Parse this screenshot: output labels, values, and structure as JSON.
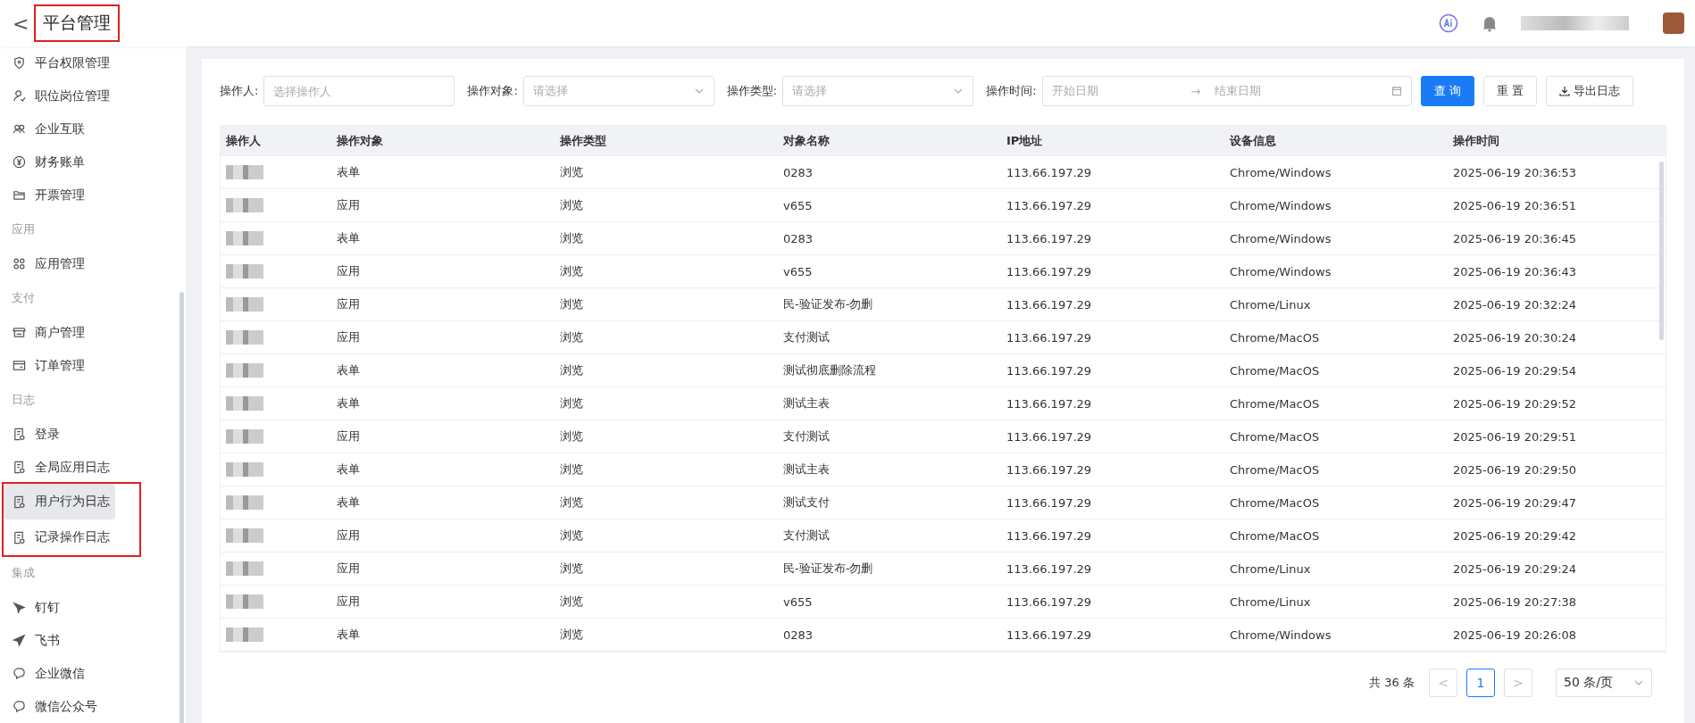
{
  "header": {
    "back": "<",
    "title": "平台管理",
    "title_highlighted": true
  },
  "sidebar": [
    {
      "kind": "item",
      "label": "平台权限管理",
      "selected": false,
      "highlighted": false
    },
    {
      "kind": "item",
      "label": "职位岗位管理",
      "selected": false,
      "highlighted": false
    },
    {
      "kind": "item",
      "label": "企业互联",
      "selected": false,
      "highlighted": false
    },
    {
      "kind": "item",
      "label": "财务账单",
      "selected": false,
      "highlighted": false
    },
    {
      "kind": "item",
      "label": "开票管理",
      "selected": false,
      "highlighted": false
    },
    {
      "kind": "section",
      "label": "应用"
    },
    {
      "kind": "item",
      "label": "应用管理",
      "selected": false,
      "highlighted": false
    },
    {
      "kind": "section",
      "label": "支付"
    },
    {
      "kind": "item",
      "label": "商户管理",
      "selected": false,
      "highlighted": false
    },
    {
      "kind": "item",
      "label": "订单管理",
      "selected": false,
      "highlighted": false
    },
    {
      "kind": "section",
      "label": "日志"
    },
    {
      "kind": "item",
      "label": "登录",
      "selected": false,
      "highlighted": false
    },
    {
      "kind": "item",
      "label": "全局应用日志",
      "selected": false,
      "highlighted": false
    },
    {
      "kind": "item",
      "label": "用户行为日志",
      "selected": true,
      "highlighted": true
    },
    {
      "kind": "item",
      "label": "记录操作日志",
      "selected": false,
      "highlighted": true
    },
    {
      "kind": "section",
      "label": "集成"
    },
    {
      "kind": "item",
      "label": "钉钉",
      "selected": false,
      "highlighted": false
    },
    {
      "kind": "item",
      "label": "飞书",
      "selected": false,
      "highlighted": false
    },
    {
      "kind": "item",
      "label": "企业微信",
      "selected": false,
      "highlighted": false
    },
    {
      "kind": "item",
      "label": "微信公众号",
      "selected": false,
      "highlighted": false
    }
  ],
  "filters": [
    {
      "kind": "text",
      "label": "操作人:",
      "placeholder": "选择操作人"
    },
    {
      "kind": "select",
      "label": "操作对象:",
      "placeholder": "请选择"
    },
    {
      "kind": "select",
      "label": "操作类型:",
      "placeholder": "请选择"
    },
    {
      "kind": "daterange",
      "label": "操作时间:",
      "start_placeholder": "开始日期",
      "separator": "→",
      "end_placeholder": "结束日期"
    }
  ],
  "buttons": [
    {
      "kind": "primary",
      "label": "查 询"
    },
    {
      "kind": "default",
      "label": "重 置"
    },
    {
      "kind": "export",
      "label": "导出日志"
    }
  ],
  "table": {
    "columns": [
      "操作人",
      "操作对象",
      "操作类型",
      "对象名称",
      "IP地址",
      "设备信息",
      "操作时间"
    ],
    "rows": [
      [
        "",
        "表单",
        "浏览",
        "0283",
        "113.66.197.29",
        "Chrome/Windows",
        "2025-06-19 20:36:53"
      ],
      [
        "",
        "应用",
        "浏览",
        "v655",
        "113.66.197.29",
        "Chrome/Windows",
        "2025-06-19 20:36:51"
      ],
      [
        "",
        "表单",
        "浏览",
        "0283",
        "113.66.197.29",
        "Chrome/Windows",
        "2025-06-19 20:36:45"
      ],
      [
        "",
        "应用",
        "浏览",
        "v655",
        "113.66.197.29",
        "Chrome/Windows",
        "2025-06-19 20:36:43"
      ],
      [
        "",
        "应用",
        "浏览",
        "民-验证发布-勿删",
        "113.66.197.29",
        "Chrome/Linux",
        "2025-06-19 20:32:24"
      ],
      [
        "",
        "应用",
        "浏览",
        "支付测试",
        "113.66.197.29",
        "Chrome/MacOS",
        "2025-06-19 20:30:24"
      ],
      [
        "",
        "表单",
        "浏览",
        "测试彻底删除流程",
        "113.66.197.29",
        "Chrome/MacOS",
        "2025-06-19 20:29:54"
      ],
      [
        "",
        "表单",
        "浏览",
        "测试主表",
        "113.66.197.29",
        "Chrome/MacOS",
        "2025-06-19 20:29:52"
      ],
      [
        "",
        "应用",
        "浏览",
        "支付测试",
        "113.66.197.29",
        "Chrome/MacOS",
        "2025-06-19 20:29:51"
      ],
      [
        "",
        "表单",
        "浏览",
        "测试主表",
        "113.66.197.29",
        "Chrome/MacOS",
        "2025-06-19 20:29:50"
      ],
      [
        "",
        "表单",
        "浏览",
        "测试支付",
        "113.66.197.29",
        "Chrome/MacOS",
        "2025-06-19 20:29:47"
      ],
      [
        "",
        "应用",
        "浏览",
        "支付测试",
        "113.66.197.29",
        "Chrome/MacOS",
        "2025-06-19 20:29:42"
      ],
      [
        "",
        "应用",
        "浏览",
        "民-验证发布-勿删",
        "113.66.197.29",
        "Chrome/Linux",
        "2025-06-19 20:29:24"
      ],
      [
        "",
        "应用",
        "浏览",
        "v655",
        "113.66.197.29",
        "Chrome/Linux",
        "2025-06-19 20:27:38"
      ],
      [
        "",
        "表单",
        "浏览",
        "0283",
        "113.66.197.29",
        "Chrome/Windows",
        "2025-06-19 20:26:08"
      ]
    ]
  },
  "pagination": {
    "total": "共 36 条",
    "prev": "<",
    "pages": [
      {
        "label": "1",
        "selected": true
      }
    ],
    "next": ">",
    "page_size": "50 条/页"
  }
}
